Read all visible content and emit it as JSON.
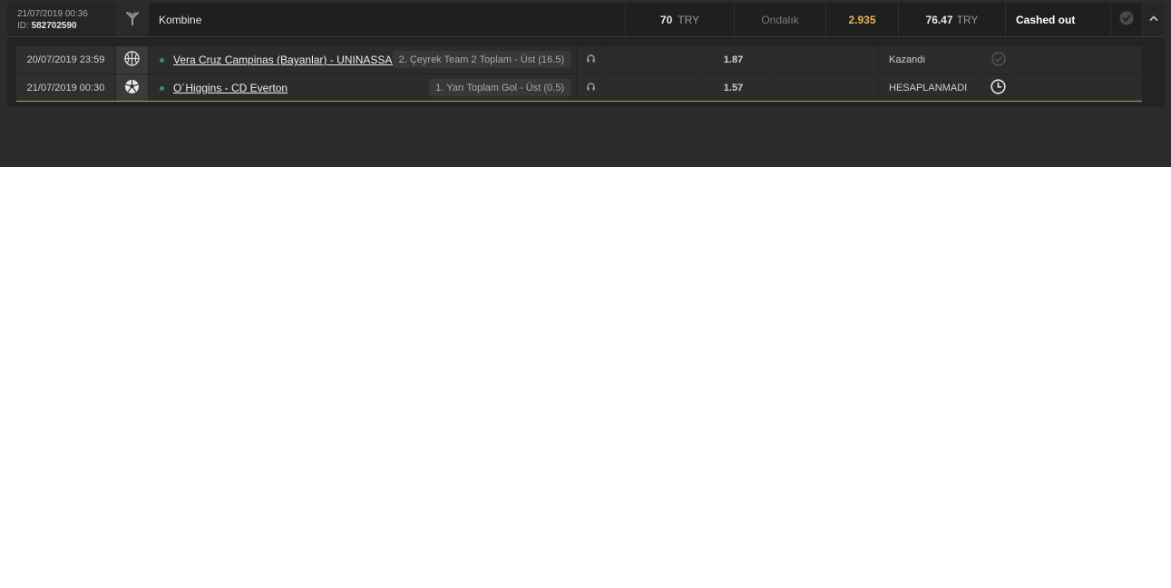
{
  "bet": {
    "date": "21/07/2019 00:36",
    "id_label": "ID:",
    "id_value": "582702590",
    "type_icon": "branch-merge-icon",
    "type": "Kombine",
    "stake_amount": "70",
    "stake_currency": "TRY",
    "odds_format": "Ondalık",
    "total_odds": "2.935",
    "return_amount": "76.47",
    "return_currency": "TRY",
    "status": "Cashed out",
    "status_icon": "check-circle-icon",
    "collapse_icon": "chevron-up-icon"
  },
  "legs": [
    {
      "date": "20/07/2019 23:59",
      "sport_icon": "basketball-icon",
      "event": "Vera Cruz Campinas (Bayanlar) - UNINASSAU/America Recife (Baya...",
      "market": "2. Çeyrek Team 2 Toplam - Üst (16.5)",
      "odds": "1.87",
      "status": "Kazandı",
      "status_icon": "check-circle-outline-icon"
    },
    {
      "date": "21/07/2019 00:30",
      "sport_icon": "soccer-ball-icon",
      "event": "O´Higgins - CD Everton",
      "market": "1. Yarı Toplam Gol - Üst (0.5)",
      "odds": "1.57",
      "status": "HESAPLANMADI",
      "status_icon": "clock-icon"
    }
  ],
  "colors": {
    "accent_gold": "#e5b454",
    "win_green": "#4d8a5a",
    "divider_gold": "#d39a2c"
  }
}
